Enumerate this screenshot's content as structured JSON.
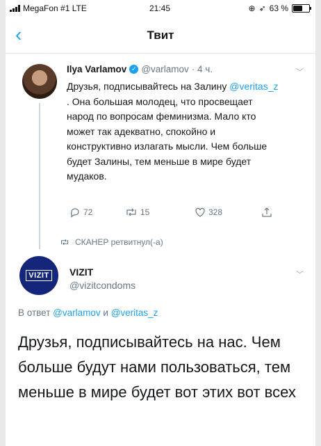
{
  "status_bar": {
    "carrier": "MegaFon #1 LTE",
    "time": "21:45",
    "battery": "63 %",
    "battery_level": 0.63
  },
  "nav": {
    "back_symbol": "‹",
    "title": "Твит"
  },
  "tweet": {
    "author_name": "Ilya Varlamov",
    "author_handle": "@varlamov",
    "time": "· 4 ч.",
    "text_before": "Друзья, подписывайтесь на Залину ",
    "mention": "@veritas_z",
    "text_after": " . Она большая молодец, что просвещает народ по вопросам феминизма. Мало кто может так адекватно, спокойно и конструктивно излагать мысли. Чем больше будет Залины, тем меньше в мире будет мудаков.",
    "replies": "72",
    "retweets": "15",
    "likes": "328"
  },
  "retweet_notice": "СКАНЕР ретвитнул(-а)",
  "reply": {
    "avatar_logo": "VIZIT",
    "author_name": "VIZIT",
    "author_handle": "@vizitcondoms",
    "reply_prefix": "В ответ ",
    "reply_user1": "@varlamov",
    "reply_and": " и ",
    "reply_user2": "@veritas_z",
    "text": "Друзья, подписывайтесь на нас. Чем больше будут нами пользоваться, тем меньше в мире будет вот этих вот всех"
  },
  "colors": {
    "accent": "#1da1f2",
    "muted": "#657786",
    "vizit_blue": "#14267a"
  }
}
